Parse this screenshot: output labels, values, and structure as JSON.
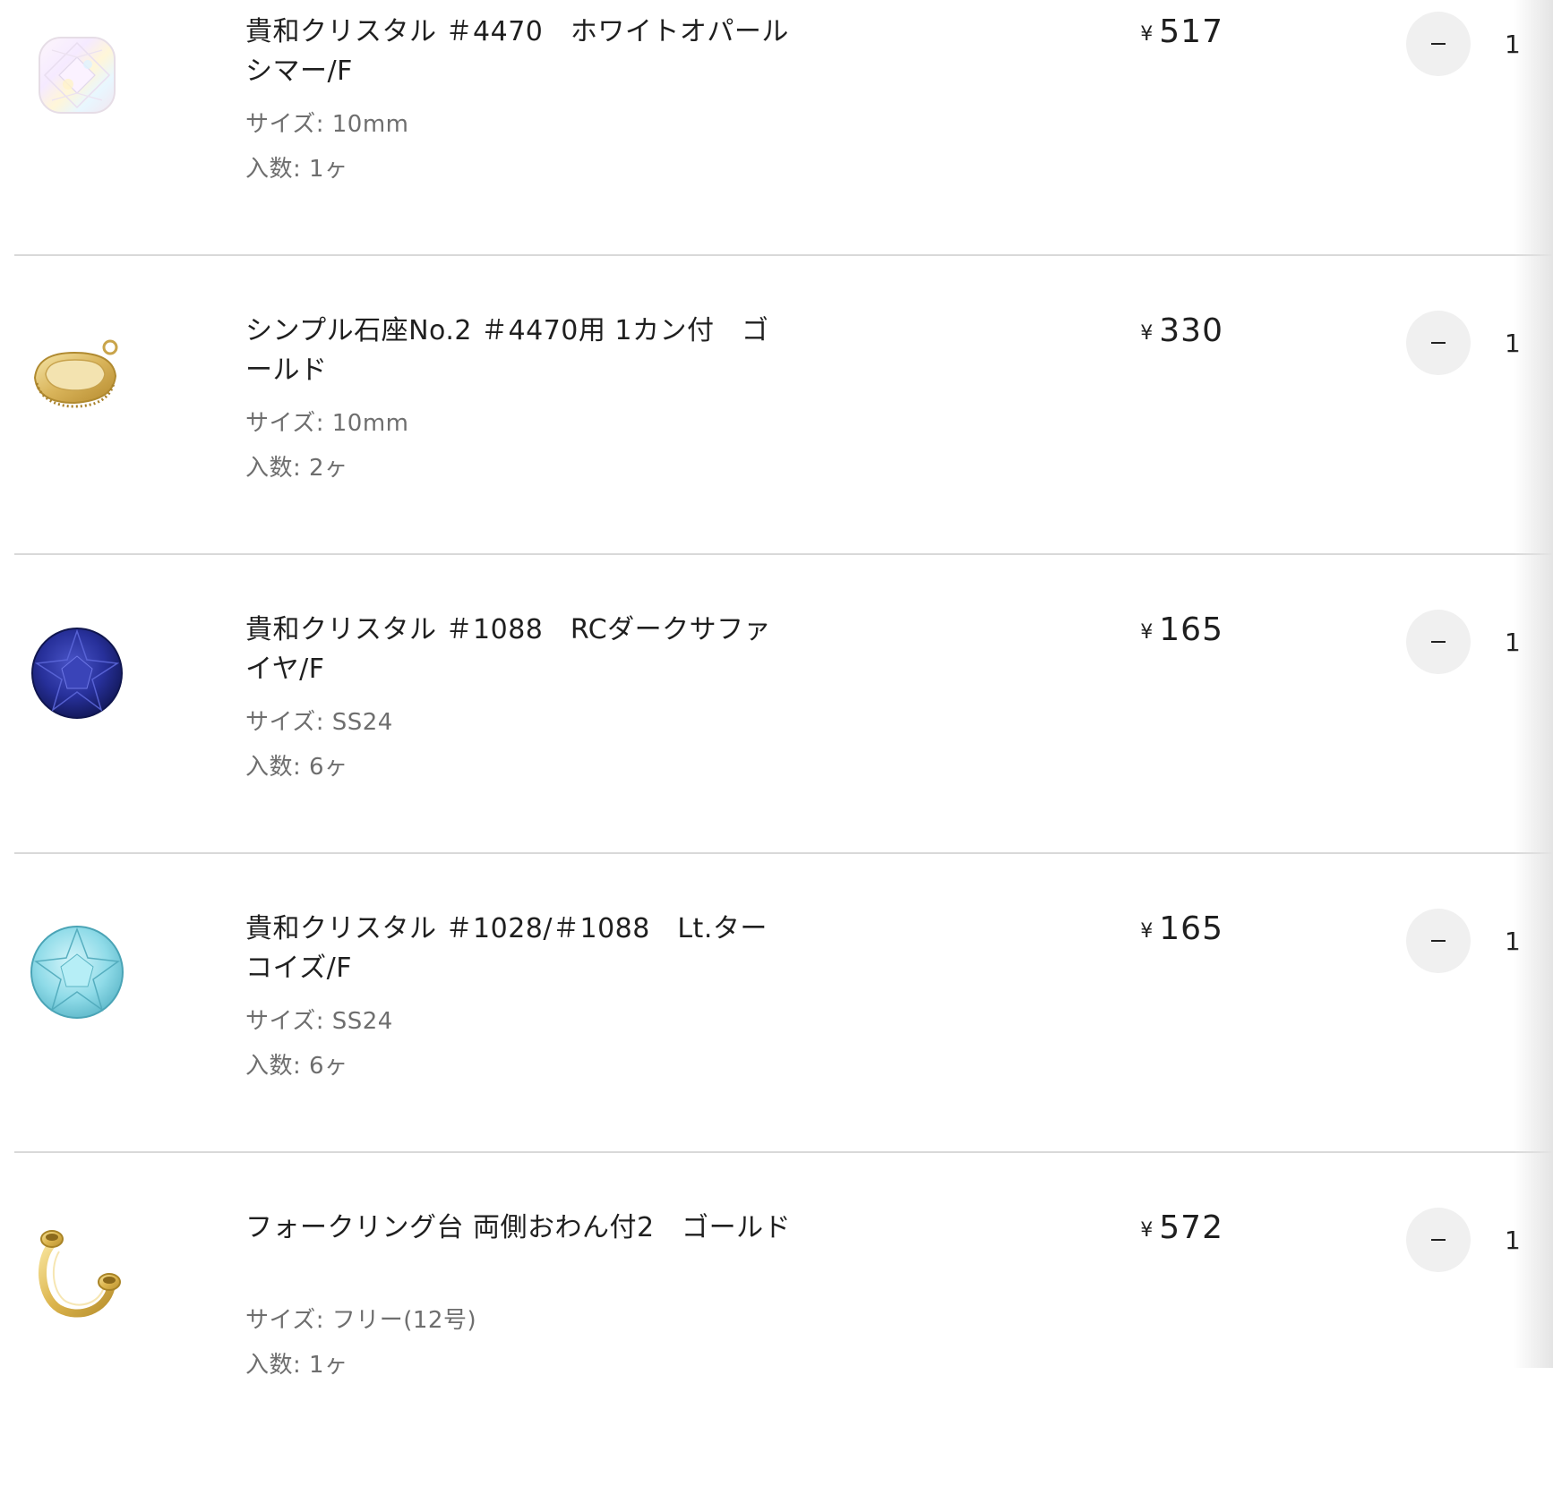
{
  "cart": {
    "items": [
      {
        "name": "貴和クリスタル ＃4470　ホワイトオパールシマー/F",
        "size": "サイズ: 10mm",
        "count": "入数: 1ヶ",
        "currency": "¥",
        "price": "517",
        "quantity": "1",
        "thumb_icon": "white-opal-square-crystal-icon"
      },
      {
        "name": "シンプル石座No.2 ＃4470用 1カン付　ゴールド",
        "size": "サイズ: 10mm",
        "count": "入数: 2ヶ",
        "currency": "¥",
        "price": "330",
        "quantity": "1",
        "thumb_icon": "gold-stone-setting-icon"
      },
      {
        "name": "貴和クリスタル ＃1088　RCダークサファイヤ/F",
        "size": "サイズ: SS24",
        "count": "入数: 6ヶ",
        "currency": "¥",
        "price": "165",
        "quantity": "1",
        "thumb_icon": "dark-sapphire-crystal-icon"
      },
      {
        "name": "貴和クリスタル ＃1028/＃1088　Lt.ターコイズ/F",
        "size": "サイズ: SS24",
        "count": "入数: 6ヶ",
        "currency": "¥",
        "price": "165",
        "quantity": "1",
        "thumb_icon": "light-turquoise-crystal-icon"
      },
      {
        "name": "フォークリング台 両側おわん付2　ゴールド",
        "size": "サイズ: フリー(12号)",
        "count": "入数: 1ヶ",
        "currency": "¥",
        "price": "572",
        "quantity": "1",
        "thumb_icon": "gold-fork-ring-icon"
      }
    ]
  },
  "colors": {
    "divider": "#d9d9d9",
    "secondary_text": "#6e6e6e",
    "button_bg": "#f0f0f0"
  }
}
